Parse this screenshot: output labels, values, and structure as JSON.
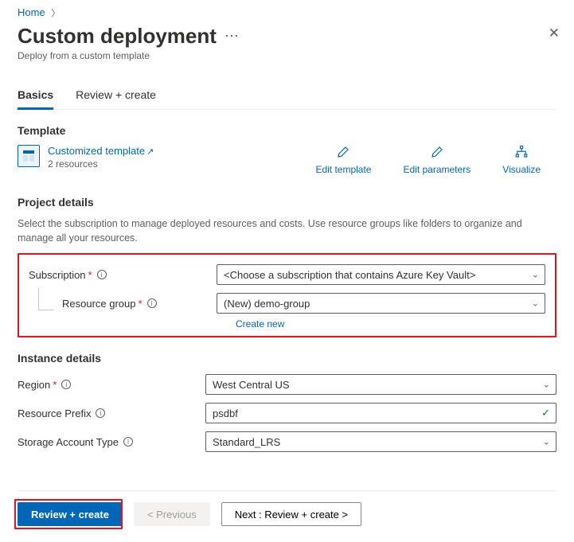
{
  "breadcrumb": {
    "home": "Home"
  },
  "title": "Custom deployment",
  "subtitle": "Deploy from a custom template",
  "tabs": {
    "basics": "Basics",
    "review": "Review + create"
  },
  "template": {
    "heading": "Template",
    "link": "Customized template",
    "resources": "2 resources"
  },
  "actions": {
    "edit_template": "Edit template",
    "edit_parameters": "Edit parameters",
    "visualize": "Visualize"
  },
  "project": {
    "heading": "Project details",
    "desc": "Select the subscription to manage deployed resources and costs. Use resource groups like folders to organize and manage all your resources.",
    "subscription_label": "Subscription",
    "subscription_value": "<Choose a subscription that contains Azure Key Vault>",
    "resource_group_label": "Resource group",
    "resource_group_value": "(New) demo-group",
    "create_new": "Create new"
  },
  "instance": {
    "heading": "Instance details",
    "region_label": "Region",
    "region_value": "West Central US",
    "prefix_label": "Resource Prefix",
    "prefix_value": "psdbf",
    "storage_label": "Storage Account Type",
    "storage_value": "Standard_LRS"
  },
  "footer": {
    "review_create": "Review + create",
    "previous": "< Previous",
    "next": "Next : Review + create >"
  }
}
